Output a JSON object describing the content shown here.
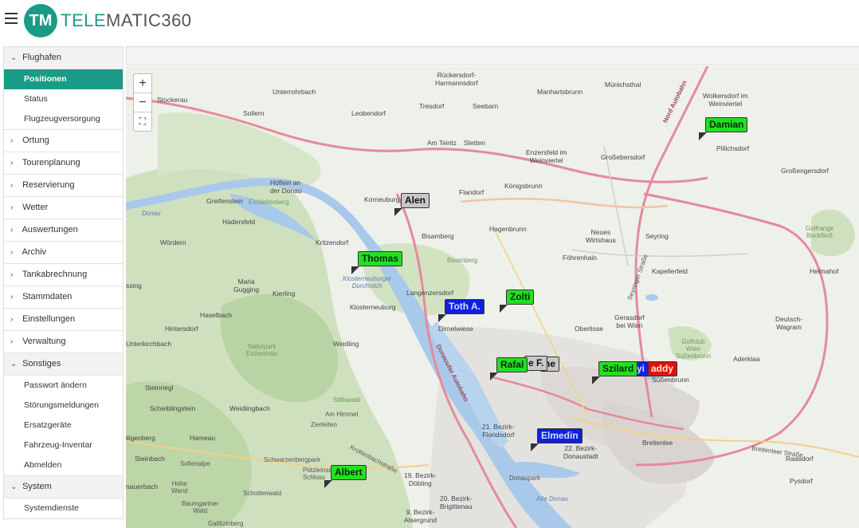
{
  "header": {
    "logo_mark": "TM",
    "logo_accent": "TELE",
    "logo_rest": "MATIC360"
  },
  "sidebar": {
    "flughafen": {
      "label": "Flughafen",
      "items": [
        "Positionen",
        "Status",
        "Flugzeugversorgung"
      ]
    },
    "sections": [
      "Ortung",
      "Tourenplanung",
      "Reservierung",
      "Wetter",
      "Auswertungen",
      "Archiv",
      "Tankabrechnung",
      "Stammdaten",
      "Einstellungen",
      "Verwaltung"
    ],
    "sonstiges": {
      "label": "Sonstiges",
      "items": [
        "Passwort ändern",
        "Störungsmeldungen",
        "Ersatzgeräte",
        "Fahrzeug-Inventar",
        "Abmelden"
      ]
    },
    "system": {
      "label": "System",
      "items": [
        "Systemdienste"
      ]
    }
  },
  "map": {
    "zoom_in": "+",
    "zoom_out": "−",
    "fullscreen": "⛶",
    "markers": {
      "damian": "Damian",
      "alen": "Alen",
      "thomas": "Thomas",
      "toth": "Toth A.",
      "zolti": "Zolti",
      "rafal": "Rafal",
      "behind_rafal": "e F.",
      "behind_rafal2": "he",
      "szilard": "Szilard",
      "szilard_behind": "yi",
      "paddy": "addy",
      "elmedin": "Elmedin",
      "albert": "Albert"
    },
    "places": {
      "rueckersdorf": "Rückersdorf-\nHarmannsdorf",
      "unterrohrbach": "Unterrohrbach",
      "manhartsbrunn": "Manhartsbrunn",
      "muenichsthal": "Münichsthal",
      "stockerau": "Stockerau",
      "tresdorf": "Tresdorf",
      "seebarn": "Seebarn",
      "wolkersdorf": "Wolkersdorf im\nWeinviertel",
      "leobendorf": "Leobendorf",
      "am_teiritz": "Am Teiritz",
      "stetten": "Stetten",
      "enzersfeld": "Enzersfeld im\nWeinviertel",
      "grossebersdorf": "Großebersdorf",
      "pillichsdorf": "Pillichsdorf",
      "hoflein": "Höflein an\nder Donau",
      "korneuburg": "Korneuburg",
      "flandorf": "Flandorf",
      "koenigsbrunn": "Königsbrunn",
      "grossengersdorf": "Großengersdorf",
      "greifenstein": "Greifenstein",
      "hadersfeld": "Hadersfeld",
      "bisamberg": "Bisamberg",
      "hagenbrunn": "Hagenbrunn",
      "neues_wirtshaus": "Neues\nWirtshaus",
      "seyring": "Seyring",
      "woerdern": "Wördern",
      "kritzendorf": "Kritzendorf",
      "foehrenhain": "Föhrenhain",
      "kapellerfeld": "Kapellerfeld",
      "helmahof": "Helmahof",
      "maria_gugging": "Maria\nGugging",
      "kierling": "Kierling",
      "langenzersdorf": "Langenzersdorf",
      "klosterneuburg": "Klosterneuburg",
      "haselbach": "Haselbach",
      "hintersdorf": "Hintersdorf",
      "strebersdorf": "Dirnelwiese",
      "oberlisse": "Oberlisse",
      "gerasdorf": "Gerasdorf\nbei Wien",
      "deutsch_wagram": "Deutsch-\nWagram",
      "unterkirchbach": "Unterkirchbach",
      "weidling": "Weidling",
      "aderklaa": "Aderklaa",
      "steinriegl": "Steinriegl",
      "suessenbrunn": "Süßenbrunn",
      "scheiblingstein": "Scheiblingstein",
      "weidlingbach": "Weidlingbach",
      "floridsdorf": "21. Bezirk-\nFloridsdorf",
      "donaustadt": "22. Bezirk-\nDonaustadt",
      "breitenlee": "Breitenlee",
      "steinbach": "Steinbach",
      "raasdorf": "Raasdorf",
      "doebling": "19. Bezirk-\nDöbling",
      "brigittenau": "20. Bezirk-\nBrigittenau",
      "alsergrund": "9. Bezirk-\nAlsergrund",
      "pysdorf": "Pysdorf",
      "hame": "Hameau",
      "stiftswald": "Stiftswald",
      "am_himmel": "Am Himmel",
      "zierleiten": "Zierleiten",
      "sofienalpe": "Sofienalpe",
      "schwarzenberg": "Schwarzenbergpark",
      "poetzleinsdorf": "Pötzleinsdorfer\nSchloss",
      "schottenwald": "Schottenwald",
      "baumgartner": "Baumgartner\nWald",
      "gallitzinberg": "Gallitzinberg",
      "hohe_wand": "Hohe\nWand",
      "hauerbach": "nauerbach",
      "illigenberg": "iligenberg",
      "ssing": "ssing",
      "donaupark": "Donaupark",
      "alte_donau": "Alte Donau",
      "naturpark": "Naturpark\nEichenhain",
      "klosterneuburger": "Klosterneuburger\nDurchstich",
      "bisamberg_green": "Bisamberg",
      "eichleiten": "Eichleitenberg",
      "donau": "Donau",
      "golfrange": "Golfrange\nBockfließ",
      "golfclub": "Golfclub\nWien\nSüßenbrunn",
      "nord_autobahn": "Nord Autobahn",
      "donauufer": "Donauufer Autobahn",
      "seyringer": "Seyringer Straße",
      "breitenleer": "Breitenleer Straße",
      "krottenbach": "Krottenbachstraße",
      "sollern": "Sollern"
    }
  }
}
